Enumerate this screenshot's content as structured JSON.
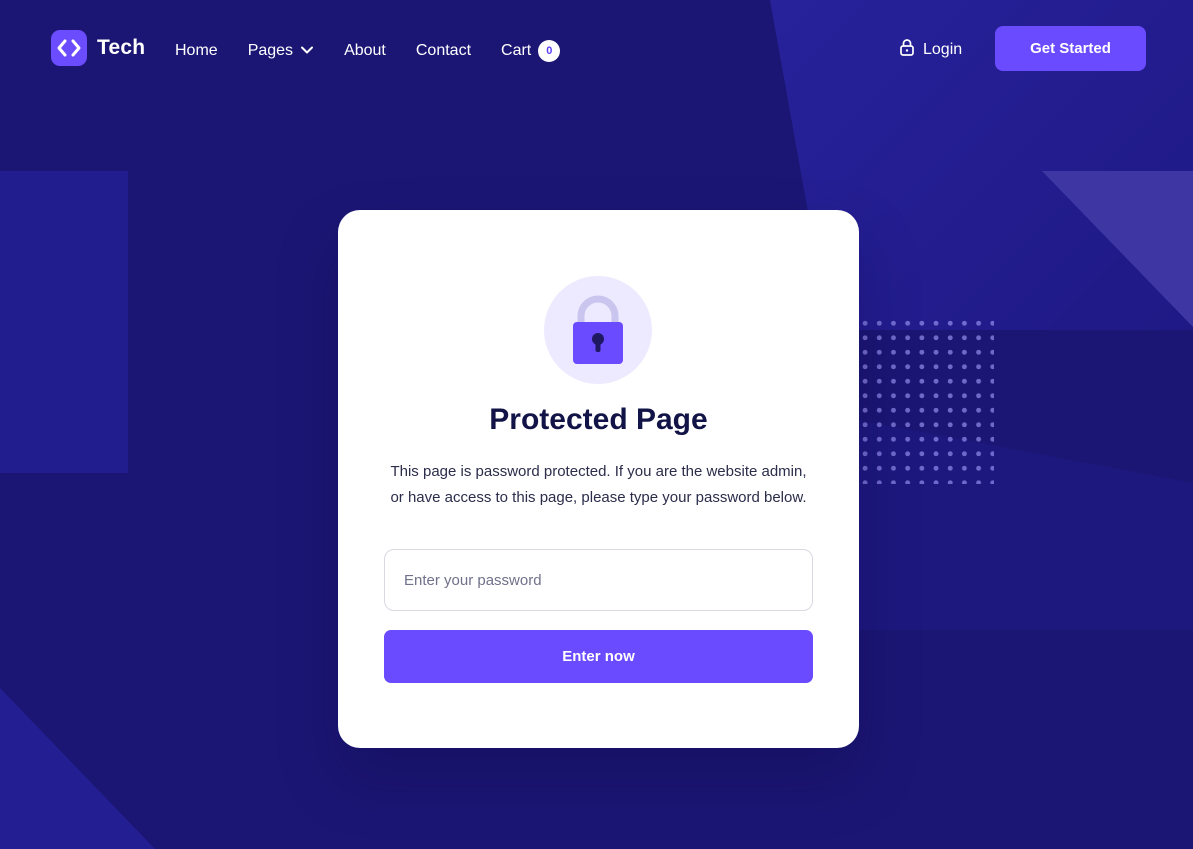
{
  "brand": {
    "name": "Tech",
    "accent": "#6a4bff",
    "logo_icon": "code-brackets-icon"
  },
  "nav": {
    "items": [
      {
        "label": "Home"
      },
      {
        "label": "Pages",
        "has_dropdown": true
      },
      {
        "label": "About"
      },
      {
        "label": "Contact"
      },
      {
        "label": "Cart",
        "badge": "0"
      }
    ],
    "login_label": "Login",
    "cta_label": "Get Started"
  },
  "card": {
    "icon": "lock-icon",
    "title": "Protected Page",
    "description": "This page is password protected. If you are the website admin, or have access to this page, please type your password below.",
    "password_placeholder": "Enter your password",
    "submit_label": "Enter now"
  },
  "colors": {
    "background": "#1b1674",
    "card": "#ffffff",
    "title": "#121346"
  }
}
